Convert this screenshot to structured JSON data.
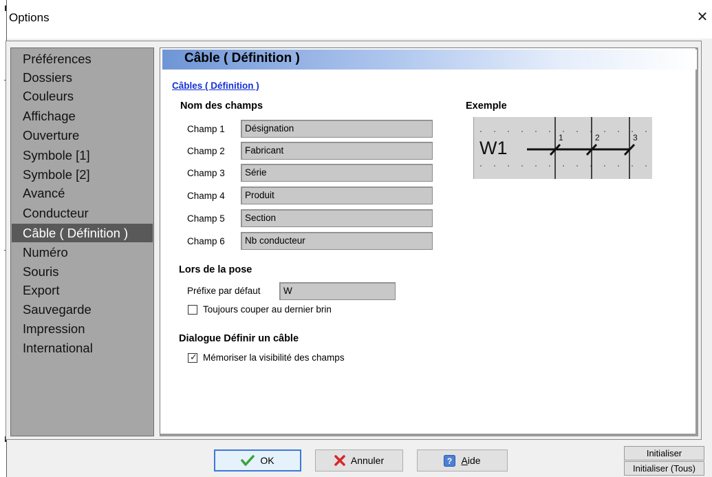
{
  "window": {
    "title": "Options",
    "close_glyph": "✕"
  },
  "nav": {
    "items": [
      {
        "label": "Préférences"
      },
      {
        "label": "Dossiers"
      },
      {
        "label": "Couleurs"
      },
      {
        "label": "Affichage"
      },
      {
        "label": "Ouverture"
      },
      {
        "label": "Symbole [1]"
      },
      {
        "label": "Symbole [2]"
      },
      {
        "label": "Avancé"
      },
      {
        "label": "Conducteur"
      },
      {
        "label": "Câble ( Définition )",
        "selected": true
      },
      {
        "label": "Numéro"
      },
      {
        "label": "Souris"
      },
      {
        "label": "Export"
      },
      {
        "label": "Sauvegarde"
      },
      {
        "label": "Impression"
      },
      {
        "label": "International"
      }
    ]
  },
  "panel": {
    "header": "Câble ( Définition )",
    "section_link": "Câbles ( Définition )",
    "fields_group": {
      "title": "Nom des champs",
      "rows": [
        {
          "label": "Champ 1",
          "value": "Désignation"
        },
        {
          "label": "Champ 2",
          "value": "Fabricant"
        },
        {
          "label": "Champ 3",
          "value": "Série"
        },
        {
          "label": "Champ 4",
          "value": "Produit"
        },
        {
          "label": "Champ 5",
          "value": "Section"
        },
        {
          "label": "Champ 6",
          "value": "Nb conducteur"
        }
      ]
    },
    "example": {
      "title": "Exemple",
      "cable_label": "W1",
      "conductor_numbers": [
        "1",
        "2",
        "3"
      ]
    },
    "pose_group": {
      "title": "Lors de la pose",
      "prefix_label": "Préfixe par défaut",
      "prefix_value": "W",
      "always_cut_label": "Toujours couper au dernier brin",
      "always_cut_checked": false
    },
    "dialog_group": {
      "title": "Dialogue Définir un câble",
      "remember_label": "Mémoriser la visibilité des champs",
      "remember_checked": true
    }
  },
  "footer": {
    "ok_label": "OK",
    "cancel_label": "Annuler",
    "help_label": "Aide",
    "reset_label": "Initialiser",
    "reset_all_label": "Initialiser (Tous)"
  },
  "colors": {
    "nav_bg": "#a6a6a6",
    "nav_selected": "#595959",
    "link": "#1531d6",
    "header_gradient_start": "#6f95d6"
  }
}
